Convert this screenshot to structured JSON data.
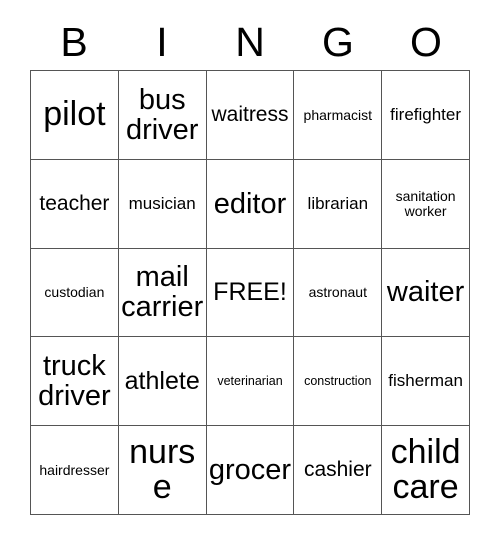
{
  "card": {
    "title_letters": [
      "B",
      "I",
      "N",
      "G",
      "O"
    ],
    "rows": [
      [
        {
          "text": "pilot",
          "size": "xxl"
        },
        {
          "text": "bus driver",
          "size": "xl"
        },
        {
          "text": "waitress",
          "size": "md"
        },
        {
          "text": "pharmacist",
          "size": "xs"
        },
        {
          "text": "firefighter",
          "size": "sm"
        }
      ],
      [
        {
          "text": "teacher",
          "size": "md"
        },
        {
          "text": "musician",
          "size": "sm"
        },
        {
          "text": "editor",
          "size": "xl"
        },
        {
          "text": "librarian",
          "size": "sm"
        },
        {
          "text": "sanitation worker",
          "size": "xs"
        }
      ],
      [
        {
          "text": "custodian",
          "size": "xs"
        },
        {
          "text": "mail carrier",
          "size": "xl"
        },
        {
          "text": "FREE!",
          "size": "lg"
        },
        {
          "text": "astronaut",
          "size": "xs"
        },
        {
          "text": "waiter",
          "size": "xl"
        }
      ],
      [
        {
          "text": "truck driver",
          "size": "xl"
        },
        {
          "text": "athlete",
          "size": "lg"
        },
        {
          "text": "veterinarian",
          "size": "xxs"
        },
        {
          "text": "construction",
          "size": "xxs"
        },
        {
          "text": "fisherman",
          "size": "sm"
        }
      ],
      [
        {
          "text": "hairdresser",
          "size": "xs"
        },
        {
          "text": "nurse",
          "size": "xxl"
        },
        {
          "text": "grocer",
          "size": "xl"
        },
        {
          "text": "cashier",
          "size": "md"
        },
        {
          "text": "child care",
          "size": "xxl"
        }
      ]
    ],
    "colors": {
      "background": "#ffffff",
      "text": "#000000",
      "grid_line": "#555555"
    }
  }
}
